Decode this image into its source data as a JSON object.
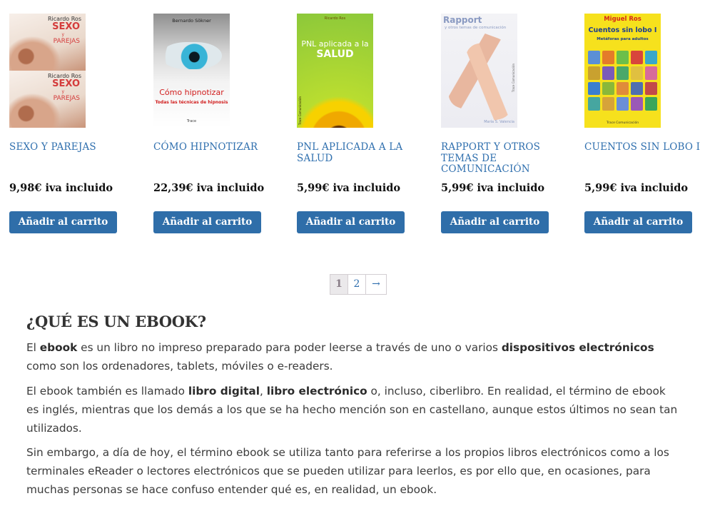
{
  "products": [
    {
      "title": "Sexo y parejas",
      "price": "9,98€ iva incluido",
      "button": "Añadir al carrito",
      "cover": {
        "author": "Ricardo Ros",
        "title_line1": "SEXO",
        "title_small": "y",
        "title_line2": "PAREJAS"
      }
    },
    {
      "title": "Cómo hipnotizar",
      "price": "22,39€ iva incluido",
      "button": "Añadir al carrito",
      "cover": {
        "author": "Bernardo Sökner",
        "title": "Cómo hipnotizar",
        "subtitle": "Todas las técnicas de hipnosis",
        "publisher": "Trace"
      }
    },
    {
      "title": "PNL aplicada a la salud",
      "price": "5,99€ iva incluido",
      "button": "Añadir al carrito",
      "cover": {
        "author": "Ricardo Ros",
        "title_line1": "PNL aplicada a la",
        "title_line2": "SALUD",
        "publisher": "Trace Comunicación"
      }
    },
    {
      "title": "Rapport y otros temas de comunicación",
      "price": "5,99€ iva incluido",
      "button": "Añadir al carrito",
      "cover": {
        "title": "Rapport",
        "subtitle": "y otros temas de comunicación",
        "author": "María S. Valencia",
        "publisher": "Trace Comunicación"
      }
    },
    {
      "title": "Cuentos sin lobo I",
      "price": "5,99€ iva incluido",
      "button": "Añadir al carrito",
      "cover": {
        "author": "Miguel Ros",
        "title": "Cuentos sin lobo I",
        "subtitle": "Metáforas para adultos",
        "publisher": "Trace Comunicación"
      }
    }
  ],
  "pagination": {
    "current": "1",
    "page2": "2",
    "next": "→"
  },
  "article": {
    "heading": "¿QUÉ ES UN EBOOK?",
    "p1": {
      "t1": "El ",
      "b1": "ebook",
      "t2": " es un libro no impreso preparado para poder leerse a través de uno o varios ",
      "b2": "dispositivos electrónicos",
      "t3": " como son los ordenadores, tablets, móviles o e-readers."
    },
    "p2": {
      "t1": "El ebook también es llamado ",
      "b1": "libro digital",
      "t2": ", ",
      "b2": "libro electrónico",
      "t3": " o, incluso, ciberlibro. En realidad, el término de ebook es inglés, mientras que los demás a los que se ha hecho mención son en castellano, aunque estos últimos no sean tan utilizados."
    },
    "p3": "Sin embargo, a día de hoy, el término ebook se utiliza tanto para referirse a los propios libros electrónicos como a los terminales eReader o lectores electrónicos que se pueden utilizar para leerlos, es por ello que, en ocasiones, para muchas personas se hace confuso entender qué es, en realidad, un ebook."
  },
  "colors": {
    "link": "#2f6fae",
    "button": "#2f6ea9",
    "text": "#3b3b3b"
  }
}
